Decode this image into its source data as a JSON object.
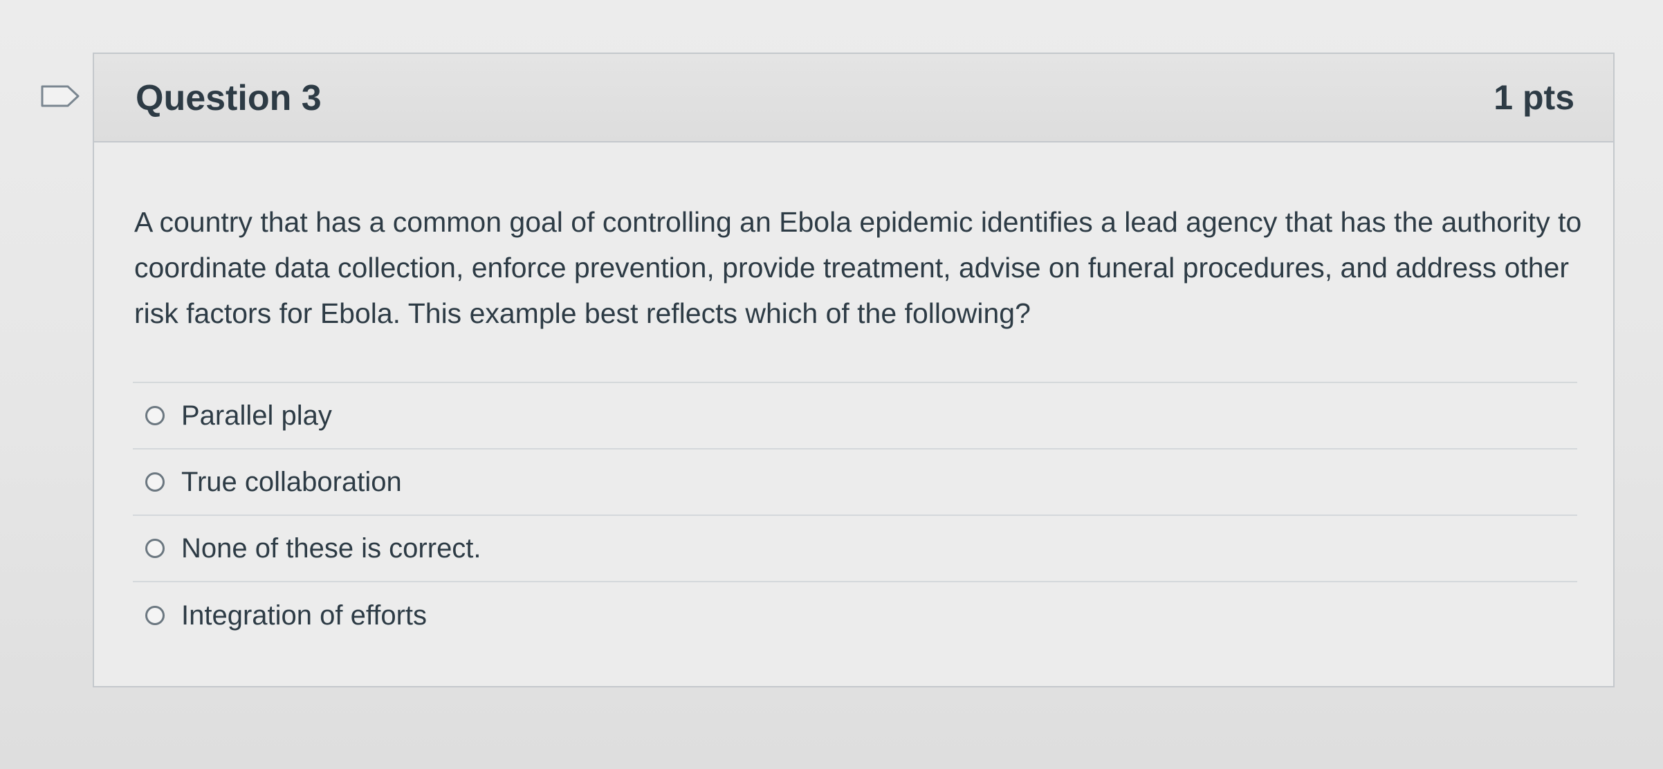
{
  "question": {
    "flag_icon": "flag-outline-icon",
    "title": "Question 3",
    "points": "1 pts",
    "text": "A country that has a common goal of controlling an Ebola epidemic identifies a lead agency that has the authority to coordinate data collection, enforce prevention, provide treatment, advise on funeral procedures, and address other risk factors for Ebola. This example best reflects which of the following?",
    "answers": [
      {
        "label": "Parallel play"
      },
      {
        "label": "True collaboration"
      },
      {
        "label": "None of these is correct."
      },
      {
        "label": "Integration of efforts"
      }
    ]
  },
  "colors": {
    "text": "#2d3b45",
    "border": "#c4c8cc",
    "header_bg": "#e0e0e0",
    "radio_border": "#6b7780"
  }
}
